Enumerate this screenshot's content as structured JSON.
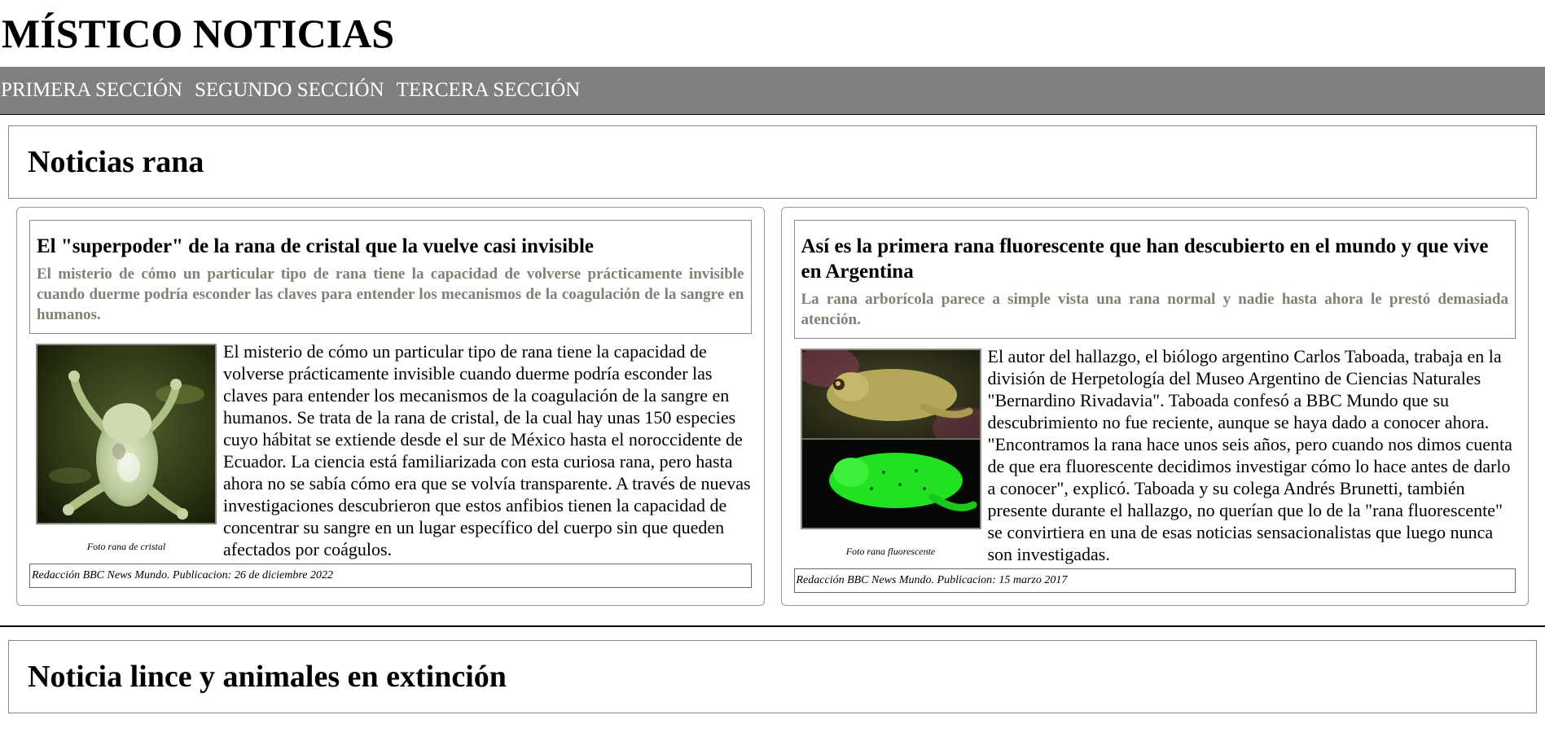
{
  "site": {
    "title": "MÍSTICO NOTICIAS"
  },
  "nav": [
    {
      "label": "PRIMERA SECCIÓN"
    },
    {
      "label": "SEGUNDO SECCIÓN"
    },
    {
      "label": "TERCERA SECCIÓN"
    }
  ],
  "sections": [
    {
      "title": "Noticias rana",
      "articles": [
        {
          "title": "El \"superpoder\" de la rana de cristal que la vuelve casi invisible",
          "lead": "El misterio de cómo un particular tipo de rana tiene la capacidad de volverse prácticamente invisible cuando duerme podría esconder las claves para entender los mecanismos de la coagulación de la sangre en humanos.",
          "body": "El misterio de cómo un particular tipo de rana tiene la capacidad de volverse prácticamente invisible cuando duerme podría esconder las claves para entender los mecanismos de la coagulación de la sangre en humanos. Se trata de la rana de cristal, de la cual hay unas 150 especies cuyo hábitat se extiende desde el sur de México hasta el noroccidente de Ecuador. La ciencia está familiarizada con esta curiosa rana, pero hasta ahora no se sabía cómo era que se volvía transparente. A través de nuevas investigaciones descubrieron que estos anfibios tienen la capacidad de concentrar su sangre en un lugar específico del cuerpo sin que queden afectados por coágulos.",
          "caption": "Foto rana de cristal",
          "byline": "Redacción BBC News Mundo. Publicacion: 26 de diciembre 2022"
        },
        {
          "title": "Así es la primera rana fluorescente que han descubierto en el mundo y que vive en Argentina",
          "lead": "La rana arborícola parece a simple vista una rana normal y nadie hasta ahora le prestó demasiada atención.",
          "body": "El autor del hallazgo, el biólogo argentino Carlos Taboada, trabaja en la división de Herpetología del Museo Argentino de Ciencias Naturales \"Bernardino Rivadavia\". Taboada confesó a BBC Mundo que su descubrimiento no fue reciente, aunque se haya dado a conocer ahora. \"Encontramos la rana hace unos seis años, pero cuando nos dimos cuenta de que era fluorescente decidimos investigar cómo lo hace antes de darlo a conocer\", explicó. Taboada y su colega Andrés Brunetti, también presente durante el hallazgo, no querían que lo de la \"rana fluorescente\" se convirtiera en una de esas noticias sensacionalistas que luego nunca son investigadas.",
          "caption": "Foto rana fluorescente",
          "byline": "Redacción BBC News Mundo. Publicacion: 15 marzo 2017"
        }
      ]
    },
    {
      "title": "Noticia lince y animales en extinción"
    }
  ]
}
